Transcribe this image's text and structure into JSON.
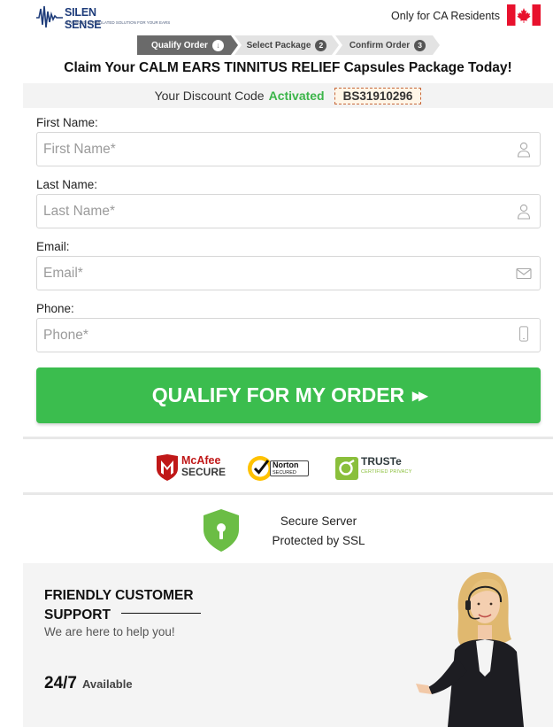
{
  "header": {
    "logo_name": "SILEN SENSE",
    "logo_tagline": "ADVANCED FORMULATED SOLUTION FOR YOUR EARS",
    "residents_text": "Only for CA Residents"
  },
  "steps": [
    {
      "label": "Qualify Order",
      "marker": "↓"
    },
    {
      "label": "Select Package",
      "marker": "2"
    },
    {
      "label": "Confirm Order",
      "marker": "3"
    }
  ],
  "headline": "Claim Your CALM EARS TINNITUS RELIEF Capsules Package Today!",
  "discount": {
    "prefix": "Your Discount Code",
    "status": "Activated",
    "code": "BS31910296"
  },
  "form": {
    "first_name": {
      "label": "First Name:",
      "placeholder": "First Name*",
      "value": ""
    },
    "last_name": {
      "label": "Last Name:",
      "placeholder": "Last Name*",
      "value": ""
    },
    "email": {
      "label": "Email:",
      "placeholder": "Email*",
      "value": ""
    },
    "phone": {
      "label": "Phone:",
      "placeholder": "Phone*",
      "value": ""
    },
    "submit_label": "QUALIFY FOR MY ORDER",
    "submit_arrows": "▸▸"
  },
  "badges": {
    "mcafee_line1": "McAfee",
    "mcafee_line2": "SECURE",
    "norton_line1": "Norton",
    "norton_line2": "SECURED",
    "truste_line1": "TRUSTe",
    "truste_line2": "CERTIFIED PRIVACY"
  },
  "ssl": {
    "line1": "Secure Server",
    "line2": "Protected by SSL"
  },
  "support": {
    "title": "FRIENDLY CUSTOMER SUPPORT",
    "subtitle": "We are here to help you!",
    "hours_big": "24/7",
    "hours_small": "Available"
  },
  "colors": {
    "accent_green": "#3bbd4e",
    "brand_blue": "#1e3c7a",
    "flag_red": "#e8112d"
  },
  "icons": {
    "first_name": "user-icon",
    "last_name": "user-icon",
    "email": "envelope-icon",
    "phone": "phone-icon",
    "ssl": "lock-shield-icon"
  }
}
